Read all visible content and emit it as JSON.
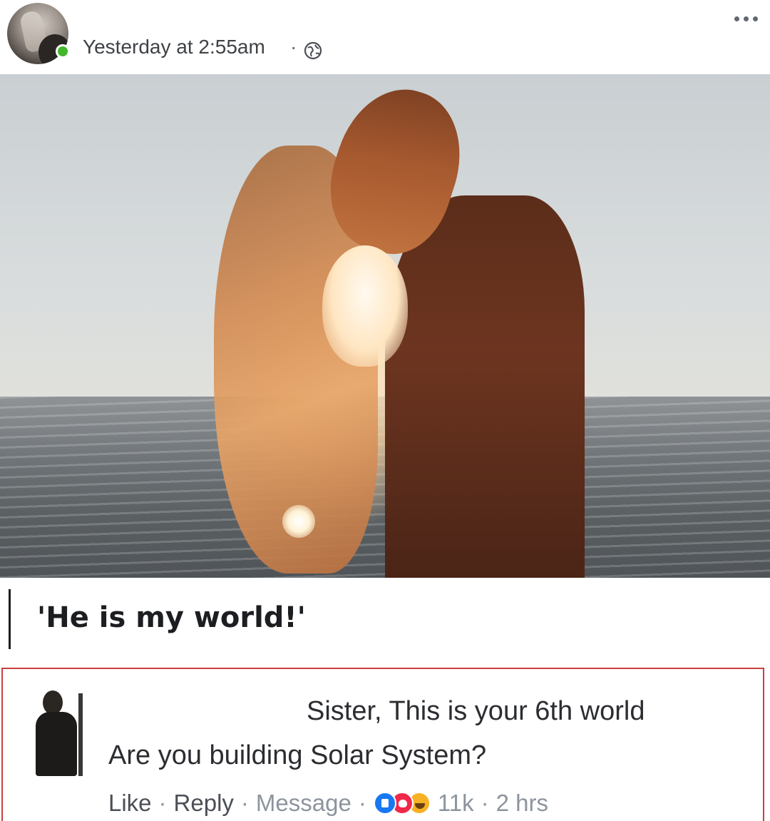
{
  "post": {
    "timestamp": "Yesterday at 2:55am",
    "timestamp_sep": "·",
    "privacy_icon": "globe-icon",
    "more_icon": "more-options-icon",
    "caption": "'He is my world!'"
  },
  "comment": {
    "line1": "Sister, This is your 6th world",
    "line2": "Are you building Solar System?",
    "actions": {
      "like": "Like",
      "reply": "Reply",
      "message": "Message",
      "sep": "·",
      "reaction_count": "11k",
      "time": "2 hrs"
    },
    "reactions": [
      "like-reaction-icon",
      "love-reaction-icon",
      "haha-reaction-icon"
    ]
  },
  "colors": {
    "highlight_border": "#c8403f",
    "online": "#42b72a",
    "like": "#1877f2",
    "love": "#f0284a",
    "haha": "#f7b125",
    "muted_text": "#8d949e"
  }
}
